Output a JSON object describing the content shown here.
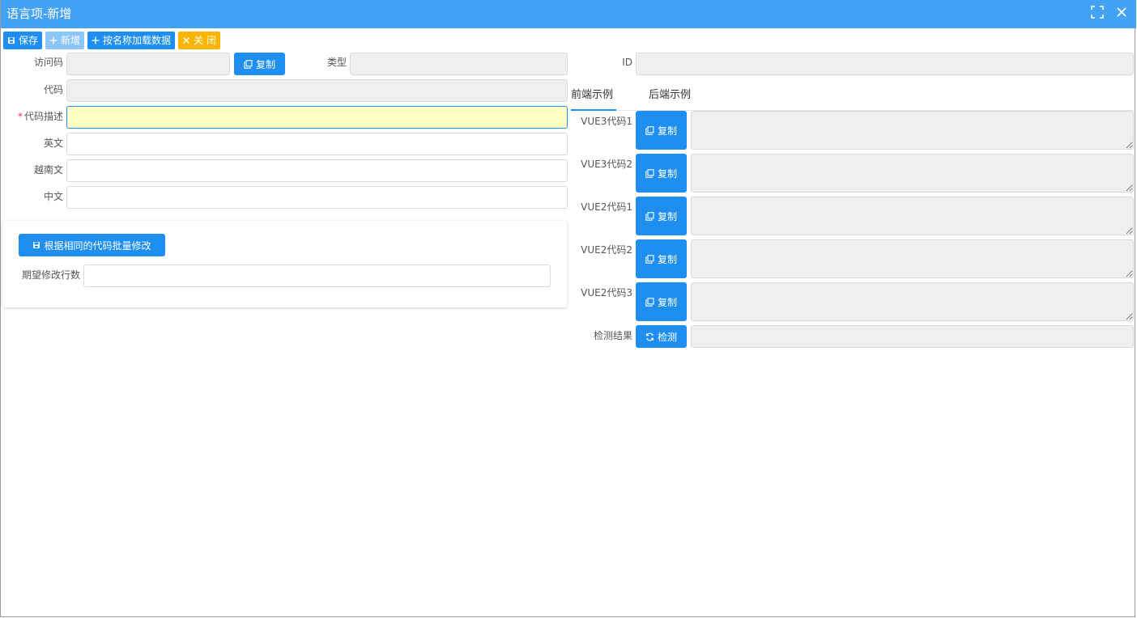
{
  "window": {
    "title": "语言项-新增"
  },
  "toolbar": {
    "save_label": "保存",
    "new_label": "新增",
    "load_by_name_label": "按名称加载数据",
    "close_label": "关 闭"
  },
  "form": {
    "access_code_label": "访问码",
    "access_code_value": "",
    "copy_label": "复制",
    "type_label": "类型",
    "type_value": "",
    "id_label": "ID",
    "id_value": "",
    "code_label": "代码",
    "code_value": "",
    "code_desc_label": "代码描述",
    "code_desc_required_mark": "*",
    "code_desc_value": "",
    "english_label": "英文",
    "english_value": "",
    "vietnamese_label": "越南文",
    "vietnamese_value": "",
    "chinese_label": "中文",
    "chinese_value": ""
  },
  "batch": {
    "button_label": "根据相同的代码批量修改",
    "expected_rows_label": "期望修改行数",
    "expected_rows_value": ""
  },
  "tabs": [
    {
      "label": "前端示例",
      "active": true
    },
    {
      "label": "后端示例",
      "active": false
    }
  ],
  "code_samples": [
    {
      "label": "VUE3代码1",
      "button": "复制",
      "value": ""
    },
    {
      "label": "VUE3代码2",
      "button": "复制",
      "value": ""
    },
    {
      "label": "VUE2代码1",
      "button": "复制",
      "value": ""
    },
    {
      "label": "VUE2代码2",
      "button": "复制",
      "value": ""
    },
    {
      "label": "VUE2代码3",
      "button": "复制",
      "value": ""
    }
  ],
  "check": {
    "label": "检测结果",
    "button": "检测",
    "value": ""
  },
  "colors": {
    "title_bar": "#43a2f3",
    "primary": "#1e8ff0",
    "disabled": "#8cc6f7",
    "warning": "#f7b500",
    "focus_bg": "#fffec4",
    "readonly_bg": "#efefef",
    "required": "#e5393f"
  },
  "icons": {
    "fullscreen": "fullscreen-icon",
    "close": "close-icon",
    "save": "save-icon",
    "plus": "plus-icon",
    "times": "times-icon",
    "copy": "copy-icon",
    "refresh": "refresh-icon"
  }
}
